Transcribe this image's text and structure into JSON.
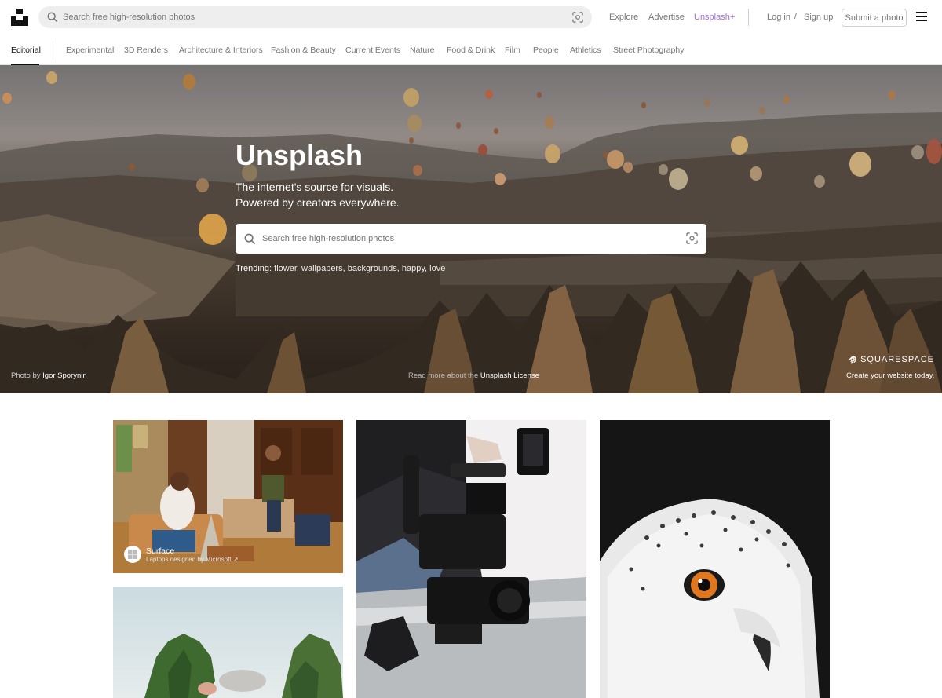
{
  "header": {
    "search_placeholder": "Search free high-resolution photos",
    "nav": {
      "explore": "Explore",
      "advertise": "Advertise",
      "plus": "Unsplash+"
    },
    "auth": {
      "login": "Log in",
      "separator": "/",
      "signup": "Sign up"
    },
    "submit": "Submit a photo"
  },
  "topics": [
    "Editorial",
    "Experimental",
    "3D Renders",
    "Architecture & Interiors",
    "Fashion & Beauty",
    "Current Events",
    "Nature",
    "Food & Drink",
    "Film",
    "People",
    "Athletics",
    "Street Photography"
  ],
  "active_topic": "Editorial",
  "hero": {
    "title": "Unsplash",
    "subtitle_line1": "The internet's source for visuals.",
    "subtitle_line2": "Powered by creators everywhere.",
    "search_placeholder": "Search free high-resolution photos",
    "trending_label": "Trending",
    "trending": [
      "flower",
      "wallpapers",
      "backgrounds",
      "happy",
      "love"
    ],
    "credit_prefix": "Photo",
    "credit_by": "by",
    "credit_author": "Igor Sporynin",
    "license_prefix": "Read more about the",
    "license_link": "Unsplash License",
    "sponsor_name": "SQUARESPACE",
    "sponsor_tagline": "Create your website today."
  },
  "ad_card": {
    "brand": "Surface",
    "tagline": "Laptops designed by Microsoft ↗"
  },
  "colors": {
    "accent_plus": "#a36dd1",
    "muted_text": "#767676",
    "search_bg": "#eeeeee"
  }
}
